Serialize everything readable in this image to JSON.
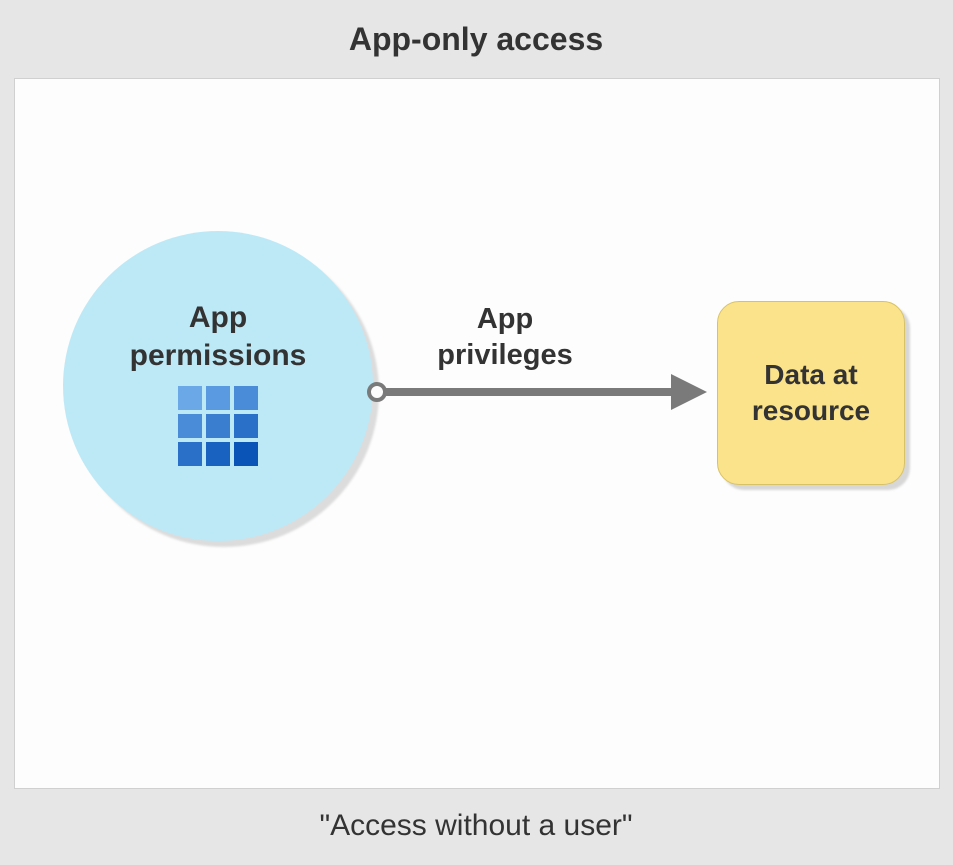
{
  "title": "App-only access",
  "footer": "\"Access without a user\"",
  "nodes": {
    "app_permissions": {
      "label_line1": "App",
      "label_line2": "permissions",
      "icon": "app-grid-icon"
    },
    "data_resource": {
      "label_line1": "Data at",
      "label_line2": "resource"
    }
  },
  "edges": {
    "app_privileges": {
      "label_line1": "App",
      "label_line2": "privileges",
      "from": "app_permissions",
      "to": "data_resource"
    }
  },
  "colors": {
    "background": "#e6e6e6",
    "canvas": "#fdfdfd",
    "circle": "#bde9f7",
    "box": "#fbe38b",
    "arrow": "#7a7a7a"
  }
}
